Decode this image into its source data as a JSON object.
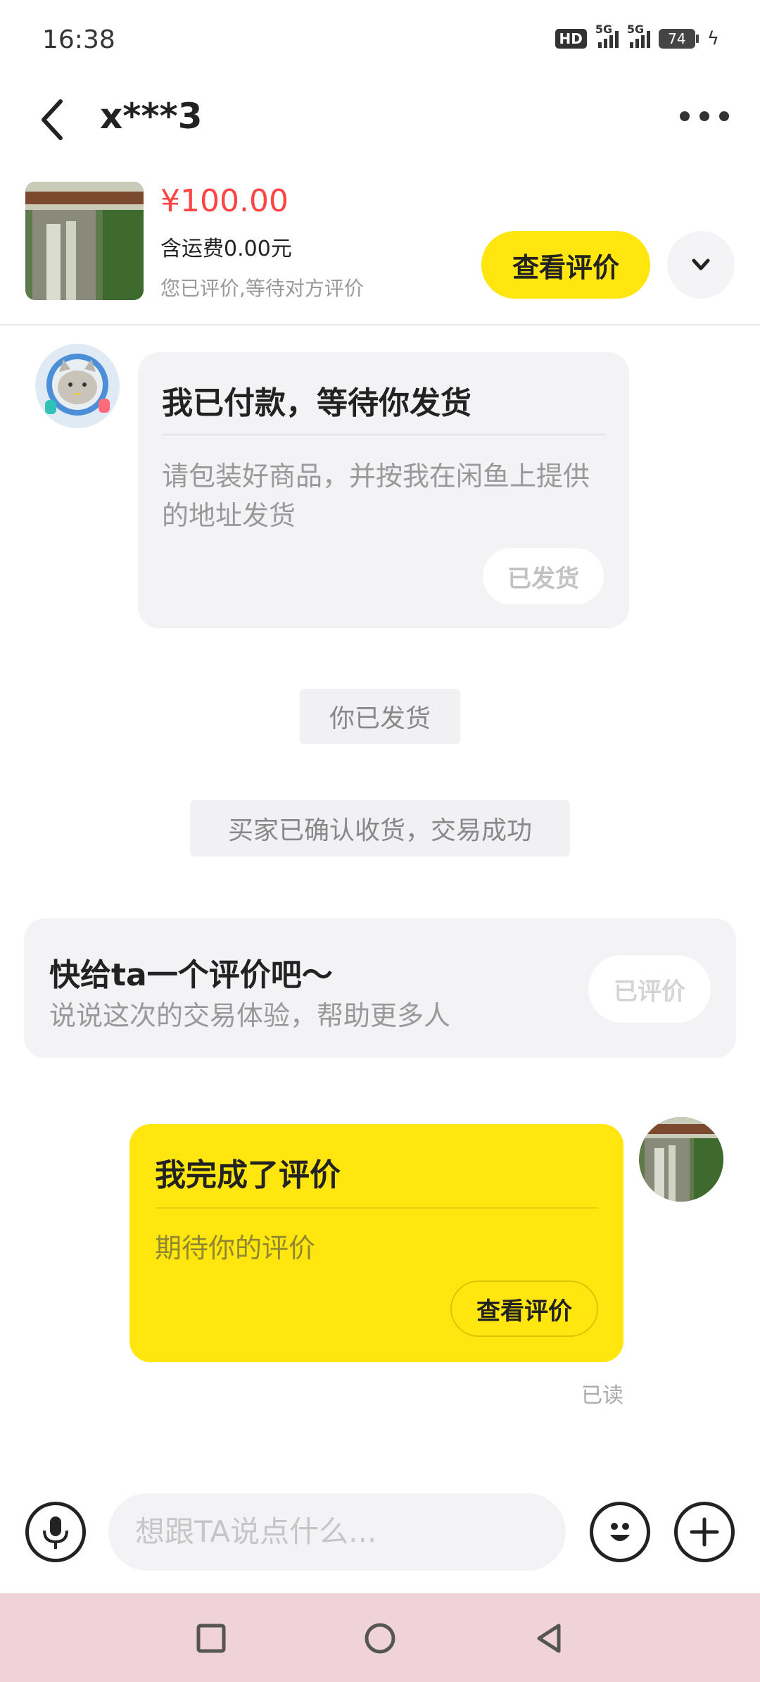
{
  "status_bar": {
    "time": "16:38",
    "hd_label": "HD",
    "signal_1_label": "5G",
    "signal_2_label": "5G",
    "battery": "74"
  },
  "header": {
    "title": "x***3"
  },
  "product": {
    "price": "¥100.00",
    "shipping": "含运费0.00元",
    "review_status": "您已评价,等待对方评价",
    "view_review_label": "查看评价"
  },
  "messages": {
    "buyer_card": {
      "title": "我已付款，等待你发货",
      "body": "请包装好商品，并按我在闲鱼上提供的地址发货",
      "button_label": "已发货"
    },
    "notice_shipped": "你已发货",
    "notice_completed": "买家已确认收货，交易成功",
    "rating_prompt": {
      "title": "快给ta一个评价吧～",
      "subtitle": "说说这次的交易体验，帮助更多人",
      "button_label": "已评价"
    },
    "my_card": {
      "title": "我完成了评价",
      "body": "期待你的评价",
      "button_label": "查看评价"
    },
    "read_receipt": "已读"
  },
  "input": {
    "placeholder": "想跟TA说点什么..."
  },
  "colors": {
    "accent_yellow": "#ffe60f",
    "price_red": "#ff4444",
    "card_gray": "#f3f3f5"
  }
}
